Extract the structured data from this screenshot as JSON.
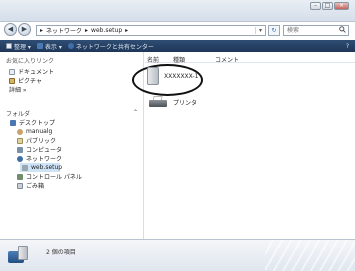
{
  "window": {
    "controls": {
      "minimize": "–",
      "maximize": "□",
      "close": "×"
    }
  },
  "navigation": {
    "back": "◀",
    "forward": "▶",
    "address": {
      "segments": [
        "ネットワーク",
        "web.setup"
      ],
      "separator": "▸",
      "dropdown": "▾"
    },
    "refresh": "↻",
    "search": {
      "placeholder": "検索",
      "icon": "search-icon"
    }
  },
  "toolbar": {
    "items": [
      {
        "label": "整理 ▾"
      },
      {
        "label": "表示 ▾"
      },
      {
        "label": "ネットワークと共有センター"
      }
    ],
    "help": "?"
  },
  "sidebar": {
    "favorites_title": "お気に入りリンク",
    "favorites": [
      {
        "label": "ドキュメント",
        "icon": "document-icon"
      },
      {
        "label": "ピクチャ",
        "icon": "pictures-icon"
      },
      {
        "label": "詳細 »",
        "icon": ""
      }
    ],
    "folders_title": "フォルダ",
    "folders_chevron": "⌃",
    "tree": [
      {
        "label": "デスクトップ",
        "icon": "desktop-icon",
        "level": 0
      },
      {
        "label": "manualg",
        "icon": "user-icon",
        "level": 1
      },
      {
        "label": "パブリック",
        "icon": "public-icon",
        "level": 1
      },
      {
        "label": "コンピュータ",
        "icon": "computer-icon",
        "level": 1
      },
      {
        "label": "ネットワーク",
        "icon": "network-icon",
        "level": 1
      },
      {
        "label": "web.setup",
        "icon": "server-icon",
        "level": 2,
        "selected": true
      },
      {
        "label": "コントロール パネル",
        "icon": "control-panel-icon",
        "level": 1
      },
      {
        "label": "ごみ箱",
        "icon": "recycle-bin-icon",
        "level": 1
      }
    ]
  },
  "content": {
    "columns": [
      "名前",
      "種類",
      "コメント"
    ],
    "items": [
      {
        "name": "XXXXXXX-1",
        "icon": "computer-tower-icon"
      },
      {
        "name": "プリンタ",
        "icon": "printer-icon"
      }
    ]
  },
  "details": {
    "count": "2 個の項目"
  }
}
